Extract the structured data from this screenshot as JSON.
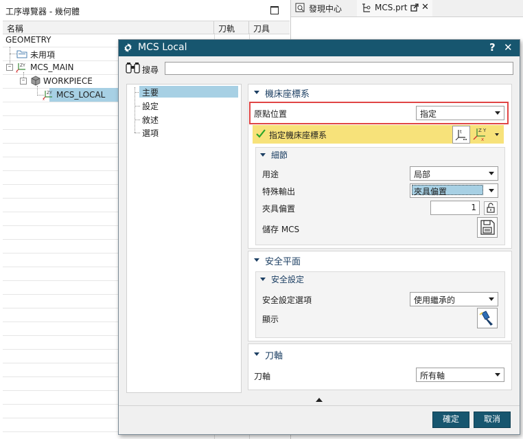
{
  "navigator": {
    "title": "工序導覽器 - 幾何體",
    "columns": [
      "名稱",
      "刀軌",
      "刀具"
    ],
    "tree": [
      {
        "label": "GEOMETRY"
      },
      {
        "label": "未用項"
      },
      {
        "label": "MCS_MAIN"
      },
      {
        "label": "WORKPIECE"
      },
      {
        "label": "MCS_LOCAL"
      }
    ]
  },
  "tabs": [
    {
      "label": "發現中心"
    },
    {
      "label": "MCS.prt"
    }
  ],
  "dialog": {
    "title": "MCS Local",
    "help": "?",
    "close": "✕",
    "search_label": "搜尋",
    "search_value": "",
    "side_items": [
      "主要",
      "設定",
      "敘述",
      "選項"
    ],
    "side_selected": "主要",
    "machine_cs": {
      "title": "機床座標系",
      "origin_label": "原點位置",
      "origin_value": "指定",
      "specify_label": "指定機床座標系",
      "details": {
        "title": "細節",
        "purpose_label": "用途",
        "purpose_value": "局部",
        "special_output_label": "特殊輸出",
        "special_output_value": "夾具偏置",
        "fixture_offset_label": "夾具偏置",
        "fixture_offset_value": "1",
        "save_mcs_label": "儲存 MCS"
      }
    },
    "clearance": {
      "title": "安全平面",
      "settings_title": "安全設定",
      "option_label": "安全設定選項",
      "option_value": "使用繼承的",
      "display_label": "顯示"
    },
    "tool_axis": {
      "title": "刀軸",
      "axis_label": "刀軸",
      "axis_value": "所有軸"
    },
    "ok_label": "確定",
    "cancel_label": "取消"
  },
  "colors": {
    "title_bar": "#17566f",
    "selection": "#a7d0e4",
    "highlight_border": "#e04545",
    "specify_row": "#f7e27a",
    "check": "#2aa52a"
  }
}
